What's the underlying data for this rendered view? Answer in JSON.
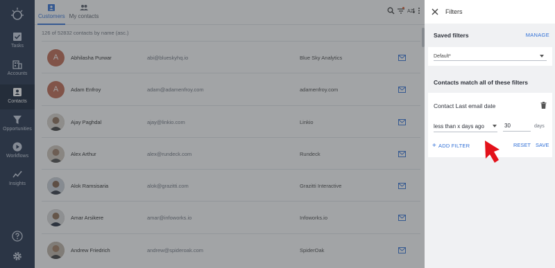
{
  "nav": {
    "items": [
      {
        "label": "Tasks",
        "icon": "checkbox-icon"
      },
      {
        "label": "Accounts",
        "icon": "building-icon"
      },
      {
        "label": "Contacts",
        "icon": "contact-card-icon"
      },
      {
        "label": "Opportunities",
        "icon": "funnel-icon"
      },
      {
        "label": "Workflows",
        "icon": "play-circle-icon"
      },
      {
        "label": "Insights",
        "icon": "chart-line-icon"
      }
    ],
    "active": "Contacts"
  },
  "tabs": [
    {
      "label": "Customers",
      "active": true
    },
    {
      "label": "My contacts",
      "active": false
    }
  ],
  "list": {
    "count_text": "126 of 52832 contacts by name (asc.)",
    "rows": [
      {
        "name": "Abhilasha Purwar",
        "email": "abi@blueskyhq.io",
        "company": "Blue Sky Analytics",
        "avatar": "A"
      },
      {
        "name": "Adam Enfroy",
        "email": "adam@adamenfroy.com",
        "company": "adamenfroy.com",
        "avatar": "A"
      },
      {
        "name": "Ajay Paghdal",
        "email": "ajay@linkio.com",
        "company": "Linkio",
        "avatar": ""
      },
      {
        "name": "Alex Arthur",
        "email": "alex@rundeck.com",
        "company": "Rundeck",
        "avatar": ""
      },
      {
        "name": "Alok Ramsisaria",
        "email": "alok@grazitti.com",
        "company": "Grazitti Interactive",
        "avatar": ""
      },
      {
        "name": "Amar Arsikere",
        "email": "amar@infoworks.io",
        "company": "Infoworks.io",
        "avatar": ""
      },
      {
        "name": "Andrew Friedrich",
        "email": "andrew@spideroak.com",
        "company": "SpiderOak",
        "avatar": ""
      }
    ]
  },
  "filters": {
    "title": "Filters",
    "saved_filters_label": "Saved filters",
    "manage_label": "MANAGE",
    "saved_filter_value": "Default*",
    "match_label": "Contacts match all of these filters",
    "filter_title": "Contact Last email date",
    "operator": "less than x days ago",
    "value": "30",
    "unit": "days",
    "add_filter_label": "ADD FILTER",
    "reset_label": "RESET",
    "save_label": "SAVE"
  },
  "colors": {
    "accent": "#2f6fd6",
    "nav_bg": "#1b2b45",
    "annotation_arrow": "#e3121b"
  }
}
